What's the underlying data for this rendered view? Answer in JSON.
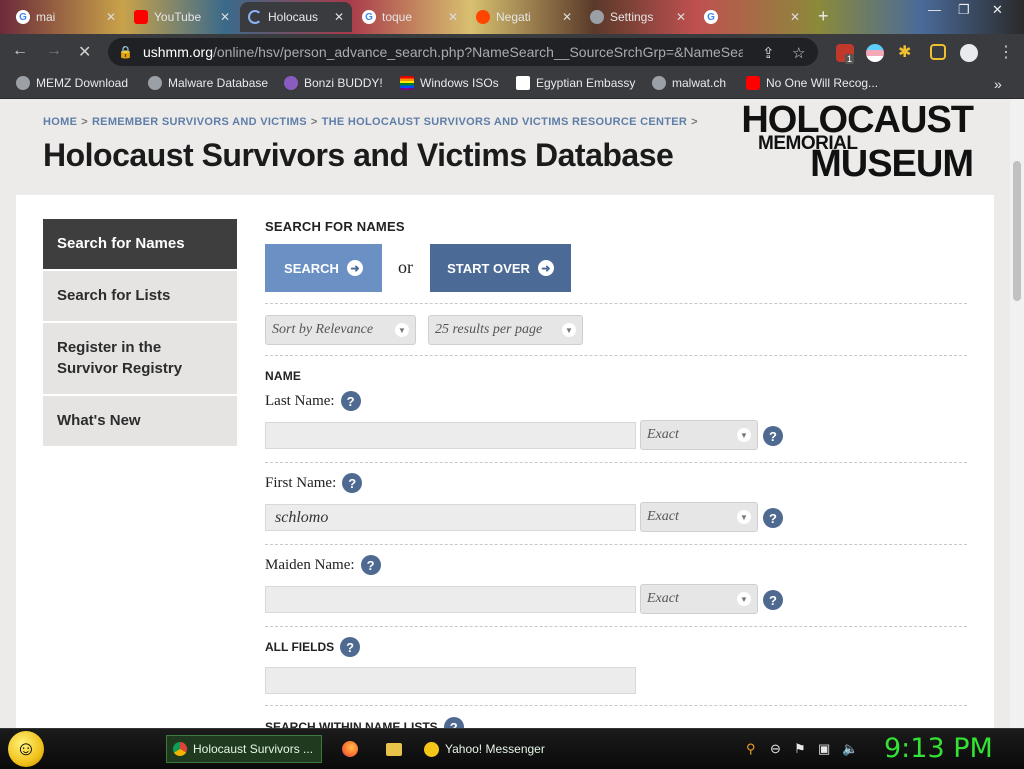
{
  "browser": {
    "tabs": [
      {
        "label": "mai",
        "icon": "google-icon",
        "active": false
      },
      {
        "label": "YouTube",
        "icon": "youtube-icon",
        "active": false
      },
      {
        "label": "Holocaus",
        "icon": "loading-icon",
        "active": true
      },
      {
        "label": "toque",
        "icon": "google-icon",
        "active": false
      },
      {
        "label": "Negati",
        "icon": "reddit-icon",
        "active": false
      },
      {
        "label": "Settings",
        "icon": "settings-icon",
        "active": false
      },
      {
        "label": "",
        "icon": "google-icon",
        "active": false
      }
    ],
    "url_domain": "ushmm.org",
    "url_path": "/online/hsv/person_advance_search.php?NameSearch__SourceSrchGrp=&NameSearc...",
    "bookmarks": [
      {
        "label": "MEMZ Download",
        "icon": "globe-icon"
      },
      {
        "label": "Malware Database",
        "icon": "globe-icon"
      },
      {
        "label": "Bonzi BUDDY!",
        "icon": "bonzi-icon"
      },
      {
        "label": "Windows ISOs",
        "icon": "rainbow-flag-icon"
      },
      {
        "label": "Egyptian Embassy",
        "icon": "wix-icon"
      },
      {
        "label": "malwat.ch",
        "icon": "globe-icon"
      },
      {
        "label": "No One Will Recog...",
        "icon": "youtube-icon"
      }
    ],
    "bookmarks_overflow": "»",
    "ext_badge": "1"
  },
  "page": {
    "breadcrumb": [
      "HOME",
      "REMEMBER SURVIVORS AND VICTIMS",
      "THE HOLOCAUST SURVIVORS AND VICTIMS RESOURCE CENTER"
    ],
    "breadcrumb_sep": ">",
    "title": "Holocaust Survivors and Victims Database",
    "logo": {
      "line1": "HOLOCAUST",
      "line2": "MEMORIAL",
      "line3": "MUSEUM"
    },
    "sidenav": [
      {
        "label": "Search for Names",
        "active": true
      },
      {
        "label": "Search for Lists",
        "active": false
      },
      {
        "label": "Register in the Survivor Registry",
        "active": false
      },
      {
        "label": "What's New",
        "active": false
      }
    ],
    "form": {
      "heading": "SEARCH FOR NAMES",
      "search_button": "SEARCH",
      "or_text": "or",
      "start_over_button": "START OVER",
      "sort_select": "Sort by Relevance",
      "per_page_select": "25 results per page",
      "name_section": "NAME",
      "last_name_label": "Last Name:",
      "last_name_value": "",
      "last_name_match": "Exact",
      "first_name_label": "First Name:",
      "first_name_value": "schlomo",
      "first_name_match": "Exact",
      "maiden_name_label": "Maiden Name:",
      "maiden_name_value": "",
      "maiden_name_match": "Exact",
      "all_fields_label": "ALL FIELDS",
      "all_fields_value": "",
      "next_section": "SEARCH WITHIN NAME LISTS",
      "help_glyph": "?"
    }
  },
  "taskbar": {
    "tasks": [
      {
        "label": "Holocaust Survivors ...",
        "icon": "chrome-icon",
        "active": true
      },
      {
        "label": "",
        "icon": "firefox-icon",
        "active": false
      },
      {
        "label": "",
        "icon": "folder-icon",
        "active": false
      },
      {
        "label": "Yahoo! Messenger",
        "icon": "yahoo-messenger-icon",
        "active": false
      }
    ],
    "clock": "9:13 PM"
  },
  "colors": {
    "search_button": "#6a90c4",
    "start_over_button": "#4b6a96",
    "help_icon": "#4f6a91",
    "breadcrumb": "#5e7ea8",
    "clock": "#34e234"
  }
}
